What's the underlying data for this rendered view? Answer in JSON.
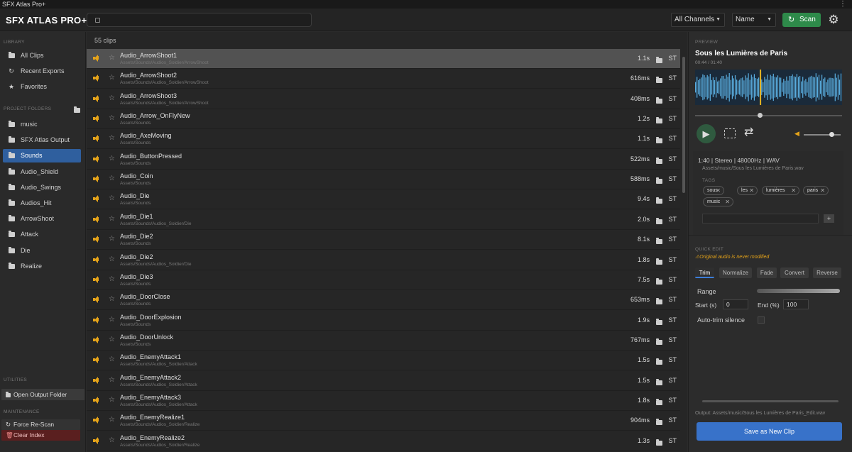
{
  "window": {
    "title": "SFX Atlas Pro+",
    "menu_icon": "more-vert-icon"
  },
  "toolbar": {
    "brand": "SFX ATLAS PRO+",
    "search_value": "",
    "channel_filter": "All Channels",
    "sort_by": "Name",
    "scan_label": "Scan"
  },
  "sidebar": {
    "library_label": "LIBRARY",
    "library_items": [
      {
        "label": "All Clips",
        "icon": "folder-icon"
      },
      {
        "label": "Recent Exports",
        "icon": "refresh-icon"
      },
      {
        "label": "Favorites",
        "icon": "star-icon"
      }
    ],
    "folders_label": "PROJECT FOLDERS",
    "folders": [
      {
        "label": "music",
        "active": false
      },
      {
        "label": "SFX Atlas Output",
        "active": false
      },
      {
        "label": "Sounds",
        "active": true
      },
      {
        "label": "Audio_Shield",
        "active": false
      },
      {
        "label": "Audio_Swings",
        "active": false
      },
      {
        "label": "Audios_Hit",
        "active": false
      },
      {
        "label": "ArrowShoot",
        "active": false
      },
      {
        "label": "Attack",
        "active": false
      },
      {
        "label": "Die",
        "active": false
      },
      {
        "label": "Realize",
        "active": false
      }
    ],
    "utilities_label": "UTILITIES",
    "open_output_label": "Open Output Folder",
    "maintenance_label": "MAINTENANCE",
    "force_rescan_label": "Force Re-Scan",
    "clear_index_label": "Clear Index"
  },
  "clips": {
    "count_label": "55 clips",
    "rows": [
      {
        "name": "Audio_ArrowShoot1",
        "path": "Assets/Sounds/Audios_Soldier/ArrowShoot",
        "duration": "1.1s",
        "channel": "ST",
        "selected": true
      },
      {
        "name": "Audio_ArrowShoot2",
        "path": "Assets/Sounds/Audios_Soldier/ArrowShoot",
        "duration": "616ms",
        "channel": "ST",
        "selected": false
      },
      {
        "name": "Audio_ArrowShoot3",
        "path": "Assets/Sounds/Audios_Soldier/ArrowShoot",
        "duration": "408ms",
        "channel": "ST",
        "selected": false
      },
      {
        "name": "Audio_Arrow_OnFlyNew",
        "path": "Assets/Sounds",
        "duration": "1.2s",
        "channel": "ST",
        "selected": false
      },
      {
        "name": "Audio_AxeMoving",
        "path": "Assets/Sounds",
        "duration": "1.1s",
        "channel": "ST",
        "selected": false
      },
      {
        "name": "Audio_ButtonPressed",
        "path": "Assets/Sounds",
        "duration": "522ms",
        "channel": "ST",
        "selected": false
      },
      {
        "name": "Audio_Coin",
        "path": "Assets/Sounds",
        "duration": "588ms",
        "channel": "ST",
        "selected": false
      },
      {
        "name": "Audio_Die",
        "path": "Assets/Sounds",
        "duration": "9.4s",
        "channel": "ST",
        "selected": false
      },
      {
        "name": "Audio_Die1",
        "path": "Assets/Sounds/Audios_Soldier/Die",
        "duration": "2.0s",
        "channel": "ST",
        "selected": false
      },
      {
        "name": "Audio_Die2",
        "path": "Assets/Sounds",
        "duration": "8.1s",
        "channel": "ST",
        "selected": false
      },
      {
        "name": "Audio_Die2",
        "path": "Assets/Sounds/Audios_Soldier/Die",
        "duration": "1.8s",
        "channel": "ST",
        "selected": false
      },
      {
        "name": "Audio_Die3",
        "path": "Assets/Sounds",
        "duration": "7.5s",
        "channel": "ST",
        "selected": false
      },
      {
        "name": "Audio_DoorClose",
        "path": "Assets/Sounds",
        "duration": "653ms",
        "channel": "ST",
        "selected": false
      },
      {
        "name": "Audio_DoorExplosion",
        "path": "Assets/Sounds",
        "duration": "1.9s",
        "channel": "ST",
        "selected": false
      },
      {
        "name": "Audio_DoorUnlock",
        "path": "Assets/Sounds",
        "duration": "767ms",
        "channel": "ST",
        "selected": false
      },
      {
        "name": "Audio_EnemyAttack1",
        "path": "Assets/Sounds/Audios_Soldier/Attack",
        "duration": "1.5s",
        "channel": "ST",
        "selected": false
      },
      {
        "name": "Audio_EnemyAttack2",
        "path": "Assets/Sounds/Audios_Soldier/Attack",
        "duration": "1.5s",
        "channel": "ST",
        "selected": false
      },
      {
        "name": "Audio_EnemyAttack3",
        "path": "Assets/Sounds/Audios_Soldier/Attack",
        "duration": "1.8s",
        "channel": "ST",
        "selected": false
      },
      {
        "name": "Audio_EnemyRealize1",
        "path": "Assets/Sounds/Audios_Soldier/Realize",
        "duration": "904ms",
        "channel": "ST",
        "selected": false
      },
      {
        "name": "Audio_EnemyRealize2",
        "path": "Assets/Sounds/Audios_Soldier/Realize",
        "duration": "1.3s",
        "channel": "ST",
        "selected": false
      }
    ]
  },
  "preview": {
    "section_label": "PREVIEW",
    "title": "Sous les Lumières de Paris",
    "time": "00:44 / 01:40",
    "playhead_fraction": 0.44,
    "volume_fraction": 0.75,
    "meta": "1:40 | Stereo | 48000Hz | WAV",
    "asset_path": "Assets/music/Sous les Lumières de Paris.wav",
    "tags_label": "TAGS",
    "tags": [
      "sous",
      "les",
      "lumières",
      "paris",
      "music"
    ],
    "add_tag_label": "+",
    "tag_input_value": "",
    "wave_color": "#5aaee0",
    "playhead_color": "#e6b422"
  },
  "quick_edit": {
    "section_label": "QUICK EDIT",
    "note": "⚠Original audio is never modified",
    "tabs": [
      "Trim",
      "Normalize",
      "Fade",
      "Convert",
      "Reverse"
    ],
    "active_tab": "Trim",
    "range_label": "Range",
    "start_label": "Start (s)",
    "start_value": "0",
    "end_label": "End (%)",
    "end_value": "100",
    "autotrim_label": "Auto-trim silence",
    "output_label": "Output: Assets/music/Sous les Lumières de Paris_Edit.wav",
    "save_label": "Save as New Clip"
  },
  "colors": {
    "accent_blue": "#3872c9",
    "scan_green": "#2e8a4a",
    "speaker_orange": "#e6a419",
    "clear_red": "#5a1f1f"
  }
}
